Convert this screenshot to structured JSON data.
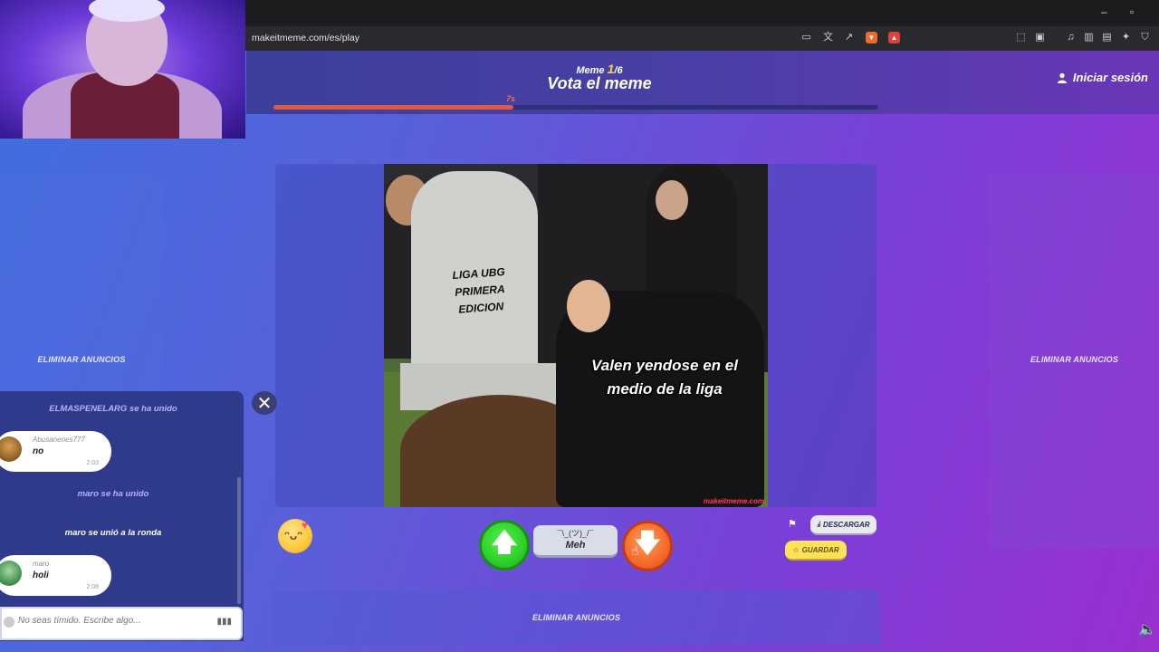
{
  "browser": {
    "url": "makeitmeme.com/es/play",
    "minimize_icon": "–",
    "restore_icon": "▫"
  },
  "header": {
    "meme_prefix": "Meme ",
    "meme_current": "1",
    "meme_total": "/6",
    "title": "Vota el meme",
    "timer": "7s",
    "progress": 0.397,
    "login_label": "Iniciar sesión"
  },
  "meme": {
    "tombstone_line1": "LIGA UBG",
    "tombstone_line2": "PRIMERA EDICION",
    "caption_line1": "Valen yendose en el",
    "caption_line2": "medio de la liga",
    "watermark": "makeitmeme.com"
  },
  "controls": {
    "up_glyph": "🡅",
    "meh_shrug": "¯\\_(ツ)_/¯",
    "meh_label": "Meh",
    "down_glyph": "🡇",
    "download_label": "DESCARGAR",
    "save_label": "GUARDAR",
    "close_glyph": "✕"
  },
  "ads": {
    "remove_label": "ELIMINAR ANUNCIOS"
  },
  "chat": {
    "messages": [
      {
        "type": "system",
        "text": "ELMASPENELARG se ha unido"
      },
      {
        "type": "bubble",
        "user": "Abusanenes777",
        "text": "no",
        "time": "2:03"
      },
      {
        "type": "system",
        "text": "maro se ha unido"
      },
      {
        "type": "system",
        "text": "maro se unió a la ronda"
      },
      {
        "type": "bubble",
        "user": "maro",
        "text": "holi",
        "time": "2:08"
      }
    ],
    "input_placeholder": "No seas tímido. Escribe algo..."
  },
  "colors": {
    "progress_fill": "#e25a3b",
    "vote_up": "#2fcf2a",
    "vote_down": "#f46a2c",
    "save": "#ffe15a",
    "system_joined": "#b8b2ff",
    "system_round": "#ffffff"
  }
}
